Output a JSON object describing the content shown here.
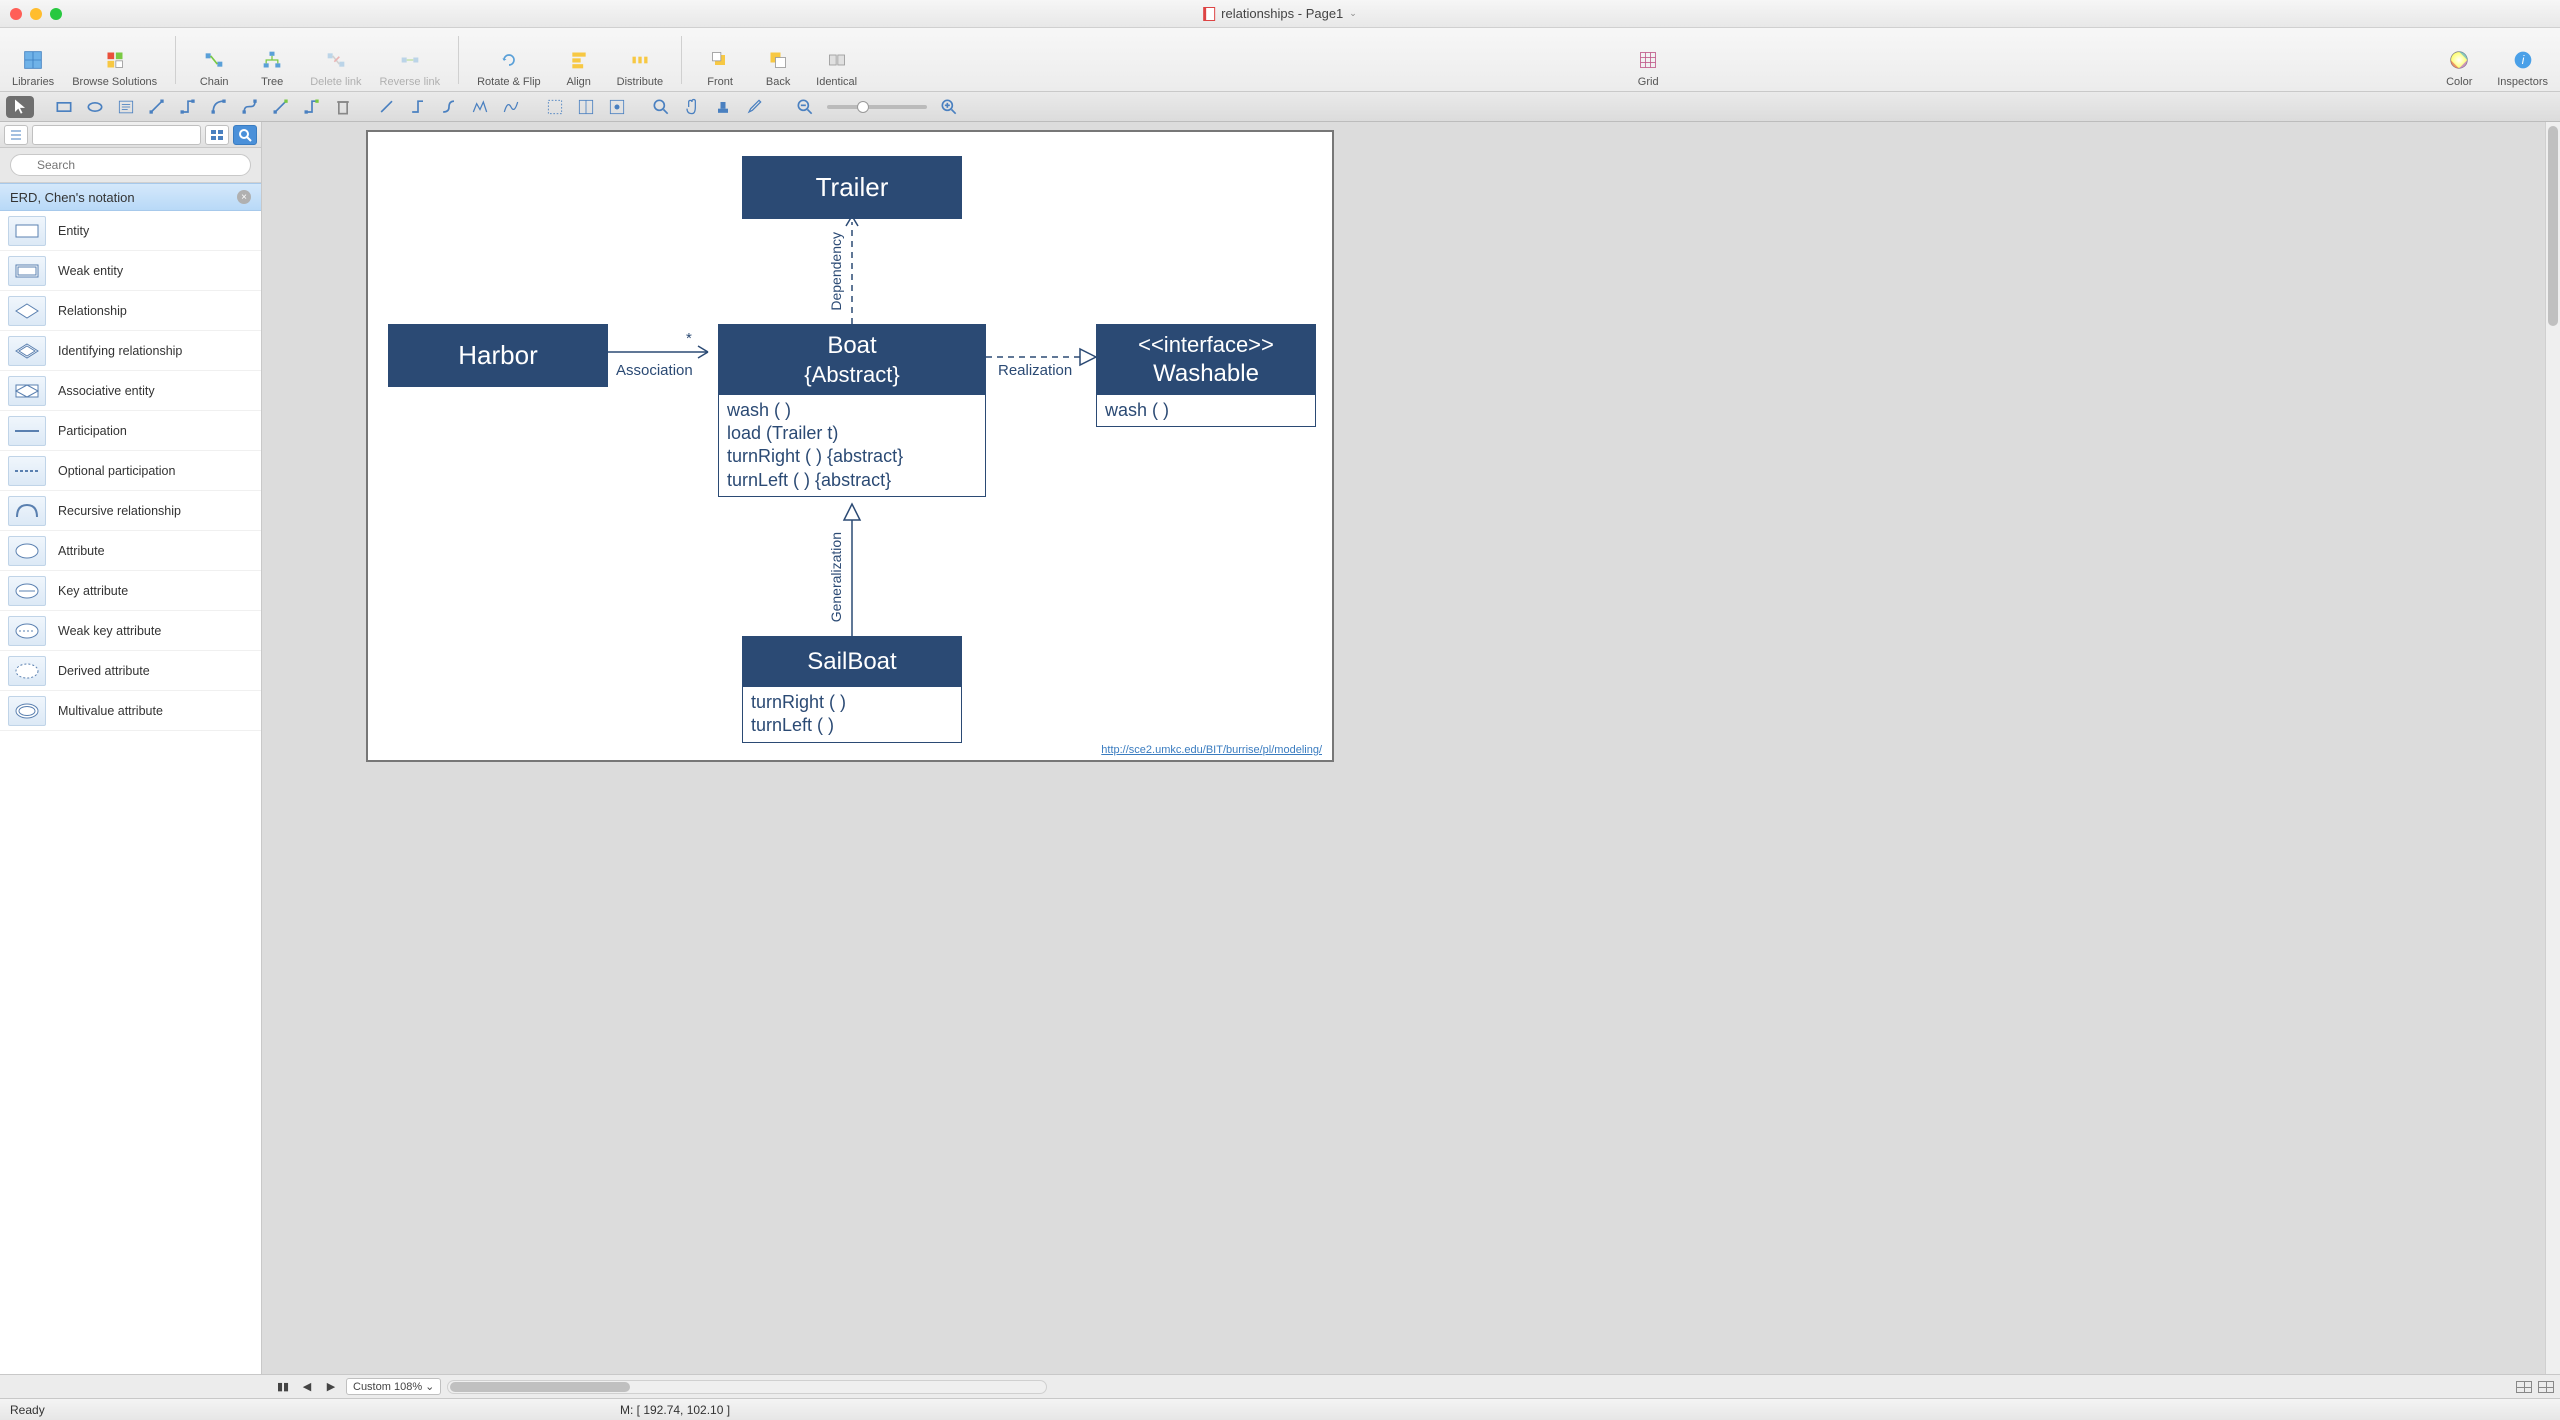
{
  "window": {
    "title": "relationships - Page1"
  },
  "toolbar": {
    "libraries": "Libraries",
    "browse": "Browse Solutions",
    "chain": "Chain",
    "tree": "Tree",
    "delete_link": "Delete link",
    "reverse_link": "Reverse link",
    "rotate_flip": "Rotate & Flip",
    "align": "Align",
    "distribute": "Distribute",
    "front": "Front",
    "back": "Back",
    "identical": "Identical",
    "grid": "Grid",
    "color": "Color",
    "inspectors": "Inspectors"
  },
  "sidebar": {
    "search_placeholder": "Search",
    "section": "ERD, Chen's notation",
    "items": [
      "Entity",
      "Weak entity",
      "Relationship",
      "Identifying relationship",
      "Associative entity",
      "Participation",
      "Optional participation",
      "Recursive relationship",
      "Attribute",
      "Key attribute",
      "Weak key attribute",
      "Derived attribute",
      "Multivalue attribute"
    ]
  },
  "diagram": {
    "trailer": "Trailer",
    "harbor": "Harbor",
    "boat_title": "Boat",
    "boat_subtitle": "{Abstract}",
    "boat_ops": [
      "wash ( )",
      "load (Trailer t)",
      "turnRight ( ) {abstract}",
      "turnLeft ( ) {abstract}"
    ],
    "washable_stereo": "<<interface>>",
    "washable_name": "Washable",
    "washable_ops": [
      "wash ( )"
    ],
    "sailboat": "SailBoat",
    "sailboat_ops": [
      "turnRight ( )",
      "turnLeft ( )"
    ],
    "lbl_dependency": "Dependency",
    "lbl_association": "Association",
    "lbl_realization": "Realization",
    "lbl_generalization": "Generalization",
    "star": "*",
    "footer_url": "http://sce2.umkc.edu/BIT/burrise/pl/modeling/"
  },
  "footer": {
    "custom": "Custom",
    "zoom": "108%",
    "ready": "Ready",
    "mouse": "M: [ 192.74, 102.10 ]"
  }
}
